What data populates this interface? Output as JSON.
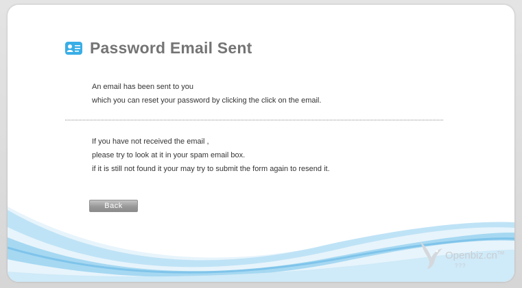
{
  "page": {
    "title": "Password Email Sent",
    "icon": "user-card-icon"
  },
  "message": {
    "line1": "An email has been sent to you",
    "line2": "which you can reset your password by clicking the click on the email."
  },
  "help": {
    "line1": "If you have not received the email ,",
    "line2": "please try to look at it in your spam email box.",
    "line3": "if it is still not found it your may try to submit the form again to resend it."
  },
  "actions": {
    "back_label": "Back"
  },
  "brand": {
    "name": "Openbiz",
    "suffix": ".cn",
    "trademark": "TM",
    "subtitle": "???",
    "icon": "bird-logo-icon"
  },
  "colors": {
    "accent": "#39aee6",
    "title": "#747474",
    "wave": "#8fcdef"
  }
}
